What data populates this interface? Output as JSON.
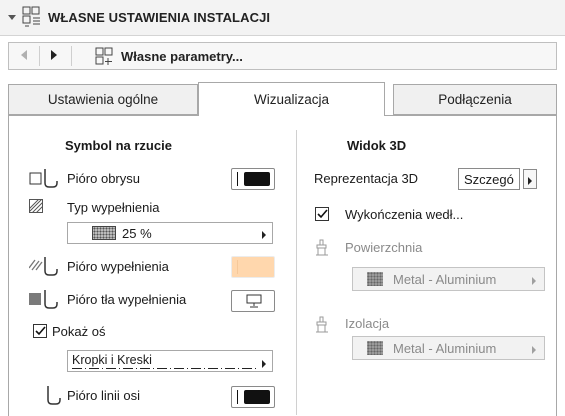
{
  "header": {
    "title": "WŁASNE USTAWIENIA INSTALACJI",
    "collapse_icon": "chevron-down-icon",
    "section_icon": "settings-grid-icon"
  },
  "navbar": {
    "title": "Własne parametry...",
    "prev_icon": "triangle-left-icon",
    "next_icon": "triangle-right-icon",
    "params_icon": "params-grid-icon"
  },
  "tabs": [
    {
      "label": "Ustawienia ogólne",
      "active": false
    },
    {
      "label": "Wizualizacja",
      "active": true
    },
    {
      "label": "Podłączenia",
      "active": false
    }
  ],
  "left": {
    "heading": "Symbol na rzucie",
    "outline_pen_label": "Pióro obrysu",
    "fill_type_label": "Typ wypełnienia",
    "fill_type_value": "25 %",
    "fill_pen_label": "Pióro wypełnienia",
    "fill_bg_pen_label": "Pióro tła wypełnienia",
    "show_axis_label": "Pokaż oś",
    "show_axis_checked": true,
    "line_type_value": "Kropki i Kreski",
    "axis_pen_label": "Pióro linii osi"
  },
  "right": {
    "heading": "Widok 3D",
    "repr_label": "Reprezentacja 3D",
    "repr_value": "Szczegó",
    "finish_label": "Wykończenia wedł...",
    "finish_checked": true,
    "surface_label": "Powierzchnia",
    "surface_value": "Metal - Aluminium",
    "insulation_label": "Izolacja",
    "insulation_value": "Metal - Aluminium"
  },
  "colors": {
    "pen_black": "#111111",
    "fill_pen_peach": "#ffd7ad",
    "disabled_text": "#8a8a8a"
  }
}
